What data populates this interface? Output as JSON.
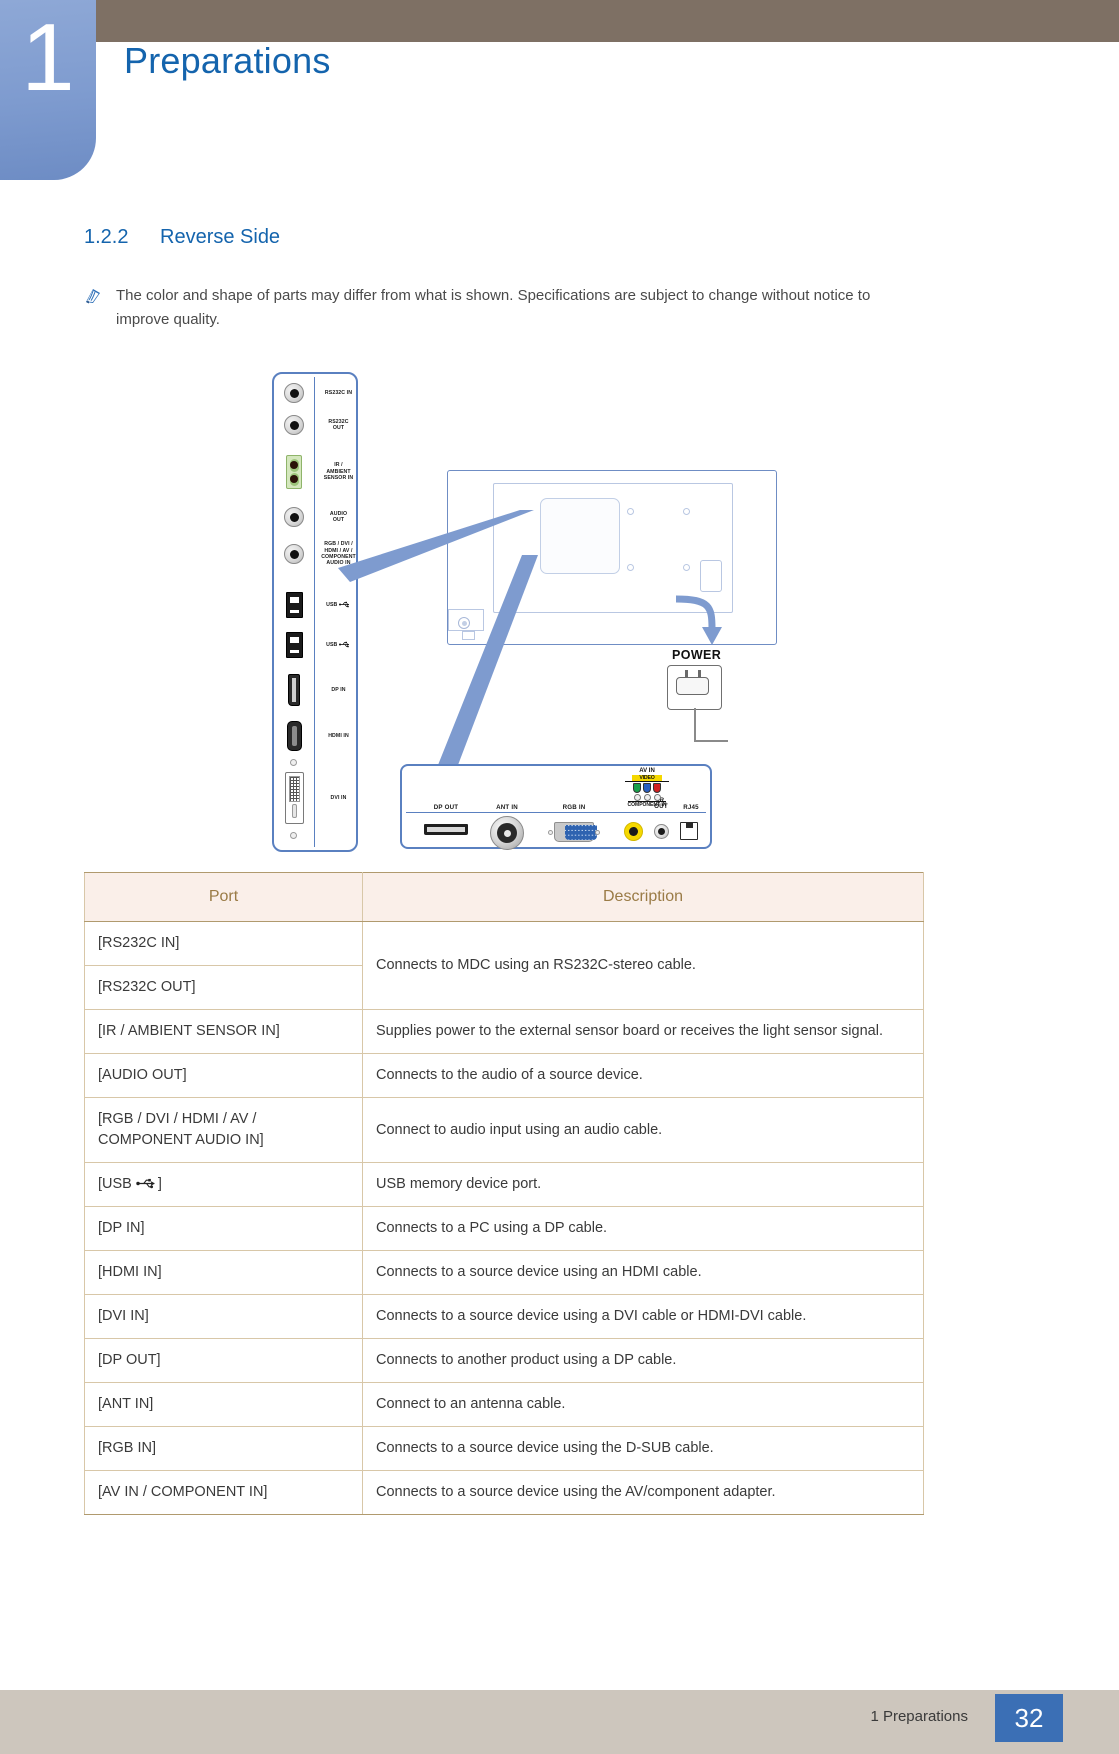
{
  "header": {
    "chapter_number": "1",
    "chapter_title": "Preparations"
  },
  "section": {
    "number": "1.2.2",
    "title": "Reverse Side"
  },
  "note": {
    "icon": "note-pen-icon",
    "text": "The color and shape of parts may differ from what is shown. Specifications are subject to change without notice to improve quality."
  },
  "diagram": {
    "side_panel_ports": [
      {
        "label": "RS232C IN",
        "jack": "round-jack-icon"
      },
      {
        "label": "RS232C\nOUT",
        "jack": "round-jack-icon"
      },
      {
        "label": "IR /\nAMBIENT\nSENSOR IN",
        "jack": "green-dual-jack-icon"
      },
      {
        "label": "AUDIO\nOUT",
        "jack": "round-jack-icon"
      },
      {
        "label": "RGB / DVI /\nHDMI / AV /\nCOMPONENT\nAUDIO IN",
        "jack": "round-jack-icon"
      },
      {
        "label": "USB",
        "jack": "usb-port-icon",
        "has_usb_glyph": true
      },
      {
        "label": "USB",
        "jack": "usb-port-icon",
        "has_usb_glyph": true
      },
      {
        "label": "DP IN",
        "jack": "displayport-icon"
      },
      {
        "label": "HDMI IN",
        "jack": "hdmi-port-icon"
      },
      {
        "label": "DVI IN",
        "jack": "dvi-port-icon"
      }
    ],
    "power_label": "POWER",
    "bottom_panel_ports": [
      {
        "label": "DP OUT"
      },
      {
        "label": "ANT IN"
      },
      {
        "label": "RGB IN"
      },
      {
        "label": "IR\nOUT"
      },
      {
        "label": "RJ45"
      }
    ],
    "av_in": {
      "title": "AV IN",
      "video_tag": "VIDEO",
      "component_caption": "COMPONENT IN"
    }
  },
  "table": {
    "headers": [
      "Port",
      "Description"
    ],
    "rows": [
      {
        "port": "[RS232C IN]",
        "description": "Connects to MDC using an RS232C-stereo cable.",
        "rowspan": 2
      },
      {
        "port": "[RS232C OUT]",
        "description": null
      },
      {
        "port": "[IR / AMBIENT SENSOR IN]",
        "description": "Supplies power to the external sensor board or receives the light sensor signal."
      },
      {
        "port": "[AUDIO OUT]",
        "description": "Connects to the audio of a source device."
      },
      {
        "port": "[RGB / DVI / HDMI / AV / COMPONENT AUDIO IN]",
        "description": "Connect to audio input using an audio cable."
      },
      {
        "port": "[USB",
        "port_suffix": "]",
        "port_icon": "usb-symbol-icon",
        "description": "USB memory device port."
      },
      {
        "port": "[DP IN]",
        "description": "Connects to a PC using a DP cable."
      },
      {
        "port": "[HDMI IN]",
        "description": "Connects to a source device using an HDMI cable."
      },
      {
        "port": "[DVI IN]",
        "description": "Connects to a source device using a DVI cable or HDMI-DVI cable."
      },
      {
        "port": "[DP OUT]",
        "description": "Connects to another product using a DP cable."
      },
      {
        "port": "[ANT IN]",
        "description": "Connect to an antenna cable."
      },
      {
        "port": "[RGB IN]",
        "description": "Connects to a source device using the D-SUB cable."
      },
      {
        "port": "[AV IN / COMPONENT IN]",
        "description": "Connects to a source device using the AV/component adapter."
      }
    ]
  },
  "footer": {
    "text": "1 Preparations",
    "page_number": "32"
  },
  "colors": {
    "accent_blue": "#1464ad",
    "chapter_tab": "#7e9bcf",
    "top_band": "#7e7064",
    "footer_band": "#cdc6bd",
    "page_badge": "#3b6fb5",
    "table_header_bg": "#faefe9",
    "table_header_text": "#9a7b46",
    "panel_border": "#5a80c0"
  }
}
